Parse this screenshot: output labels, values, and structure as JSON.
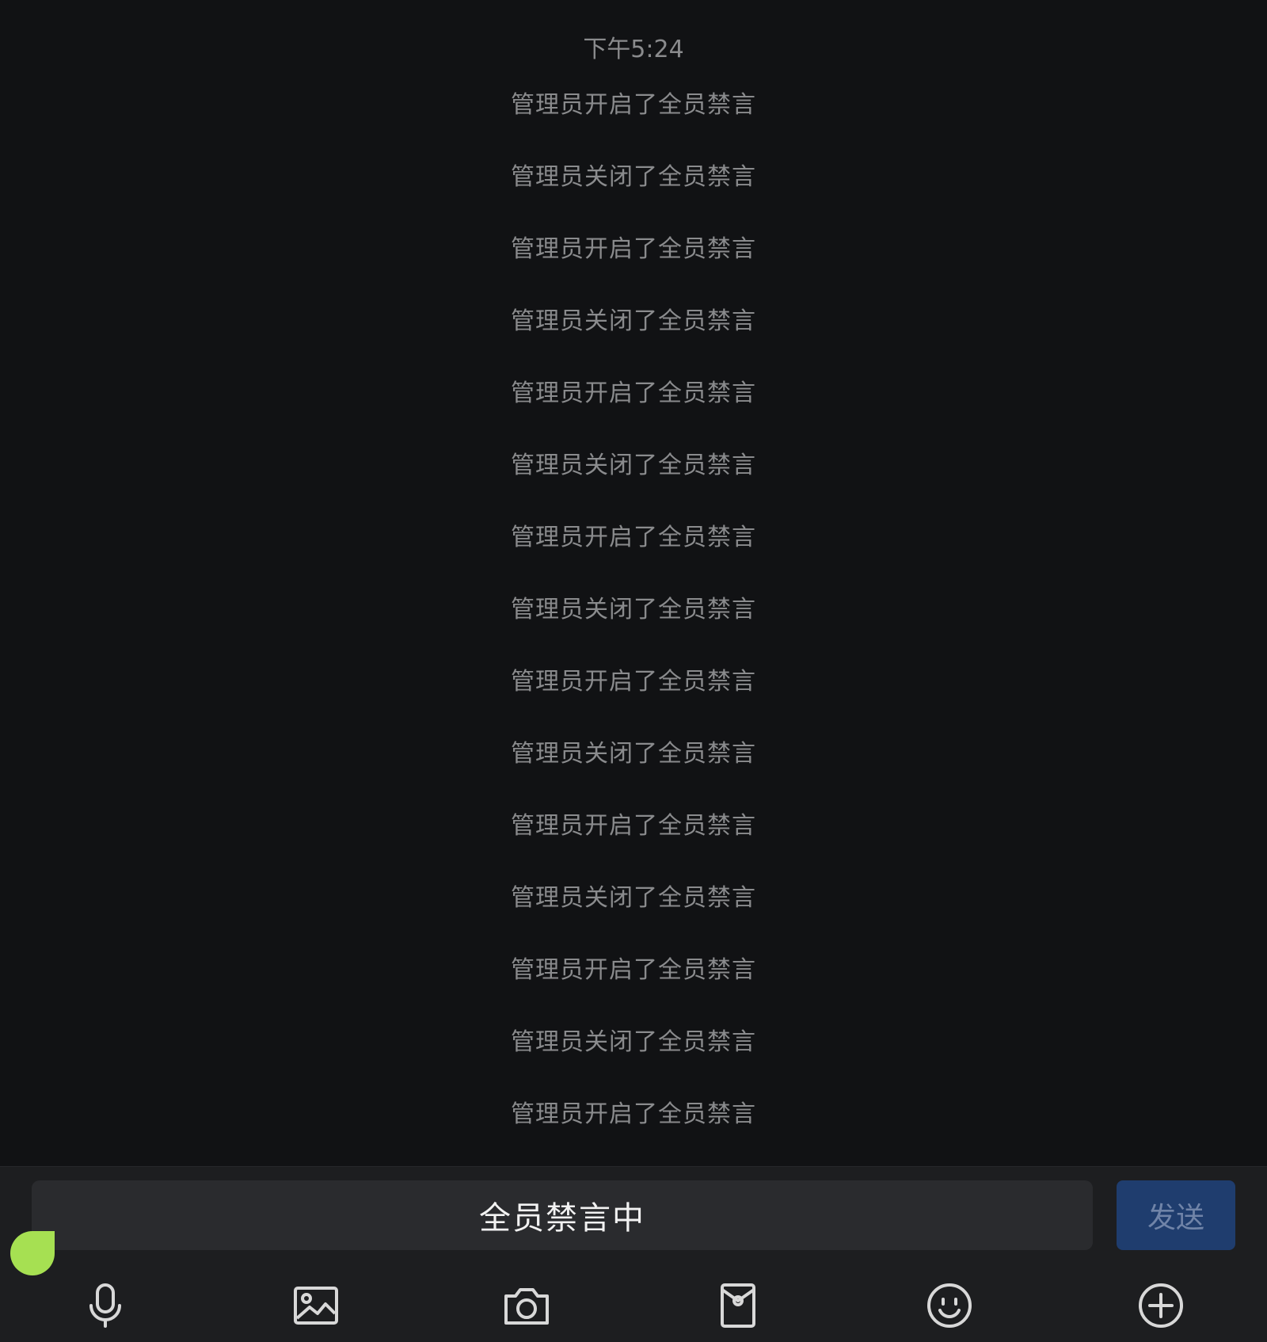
{
  "chat": {
    "timestamp": "下午5:24",
    "system_messages": [
      "管理员开启了全员禁言",
      "管理员关闭了全员禁言",
      "管理员开启了全员禁言",
      "管理员关闭了全员禁言",
      "管理员开启了全员禁言",
      "管理员关闭了全员禁言",
      "管理员开启了全员禁言",
      "管理员关闭了全员禁言",
      "管理员开启了全员禁言",
      "管理员关闭了全员禁言",
      "管理员开启了全员禁言",
      "管理员关闭了全员禁言",
      "管理员开启了全员禁言",
      "管理员关闭了全员禁言",
      "管理员开启了全员禁言"
    ]
  },
  "input": {
    "muted_text": "全员禁言中",
    "send_label": "发送"
  },
  "toolbar": {
    "icons": [
      "microphone-icon",
      "image-icon",
      "camera-icon",
      "red-packet-icon",
      "emoji-icon",
      "plus-icon"
    ]
  },
  "colors": {
    "background": "#111214",
    "bar": "#1d1e20",
    "send": "#1f3d6e",
    "dot": "#a6e052"
  }
}
